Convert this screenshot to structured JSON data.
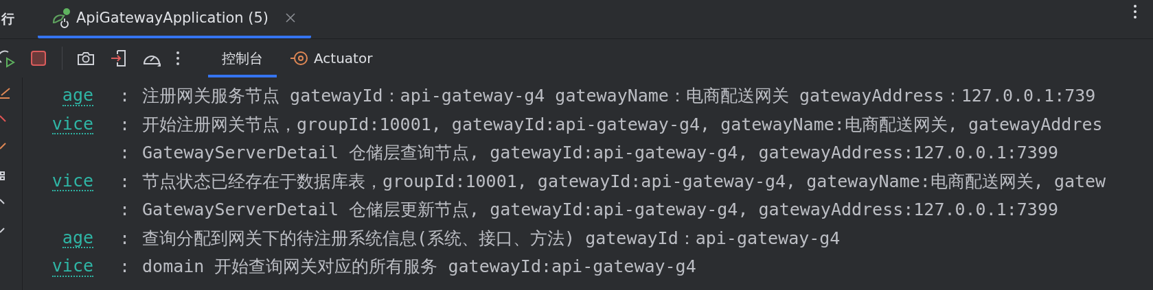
{
  "run_panel": {
    "title": "行"
  },
  "tabs": [
    {
      "label": "ApiGatewayApplication (5)",
      "selected": true
    }
  ],
  "toolbar": {
    "tabs": [
      {
        "label": "控制台",
        "selected": true,
        "kind": "plain"
      },
      {
        "label": "Actuator",
        "selected": false,
        "kind": "actuator"
      }
    ]
  },
  "console": {
    "lines": [
      {
        "logger": "age",
        "separator": ":",
        "message": "注册网关服务节点 gatewayId：api-gateway-g4 gatewayName：电商配送网关 gatewayAddress：127.0.0.1:739"
      },
      {
        "logger": "vice",
        "separator": ":",
        "message": "开始注册网关节点，groupId:10001, gatewayId:api-gateway-g4, gatewayName:电商配送网关, gatewayAddres"
      },
      {
        "separator": ":",
        "message": "GatewayServerDetail 仓储层查询节点, gatewayId:api-gateway-g4, gatewayAddress:127.0.0.1:7399"
      },
      {
        "logger": "vice",
        "separator": ":",
        "message": "节点状态已经存在于数据库表，groupId:10001, gatewayId:api-gateway-g4, gatewayName:电商配送网关, gatew"
      },
      {
        "separator": ":",
        "message": "GatewayServerDetail 仓储层更新节点, gatewayId:api-gateway-g4, gatewayAddress:127.0.0.1:7399"
      },
      {
        "logger": "age",
        "separator": ":",
        "message": "查询分配到网关下的待注册系统信息(系统、接口、方法) gatewayId：api-gateway-g4"
      },
      {
        "logger": "vice",
        "separator": ":",
        "message": "domain 开始查询网关对应的所有服务 gatewayId:api-gateway-g4"
      }
    ]
  }
}
